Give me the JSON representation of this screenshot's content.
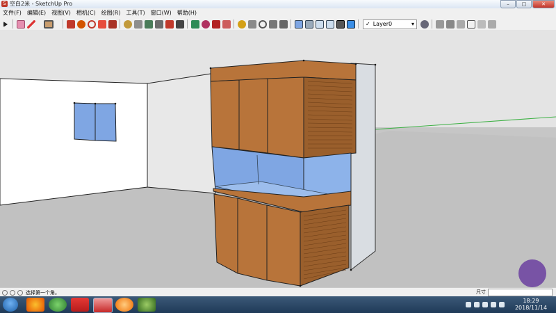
{
  "window": {
    "title": "空白2米 - SketchUp Pro",
    "buttons": [
      "–",
      "□",
      "✕"
    ]
  },
  "menu": [
    "文件(F)",
    "编辑(E)",
    "视图(V)",
    "相机(C)",
    "绘图(R)",
    "工具(T)",
    "窗口(W)",
    "帮助(H)"
  ],
  "toolbar": {
    "layer_value": "Layer0",
    "check": "✓"
  },
  "status": {
    "hint": "选择第一个角。",
    "measure_label": "尺寸"
  },
  "taskbar": {
    "time": "18:29",
    "date": "2018/11/14"
  },
  "colors": {
    "wood": "#b8743a",
    "wood_dark": "#8a5426",
    "glass": "#7fa6e3",
    "wall": "#ffffff",
    "side_wall": "#e6e6e6",
    "ground": "#c4c4c4",
    "sky": "#e2e2e2",
    "green_axis": "#3cb043"
  }
}
